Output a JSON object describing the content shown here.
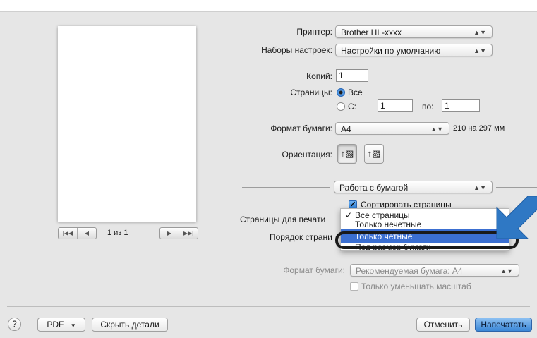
{
  "printer": {
    "label": "Принтер:",
    "value": "Brother HL-xxxx"
  },
  "presets": {
    "label": "Наборы настроек:",
    "value": "Настройки по умолчанию"
  },
  "copies": {
    "label": "Копий:",
    "value": "1"
  },
  "pages": {
    "label": "Страницы:",
    "all_label": "Все",
    "from_label": "С:",
    "from_value": "1",
    "to_label": "по:",
    "to_value": "1"
  },
  "paper_size": {
    "label": "Формат бумаги:",
    "value": "A4",
    "dimensions": "210 на 297 мм"
  },
  "orientation": {
    "label": "Ориентация:"
  },
  "section_popup": {
    "value": "Работа с бумагой"
  },
  "collate": {
    "label": "Сортировать страницы",
    "checked": true
  },
  "pages_to_print": {
    "label": "Страницы для печати"
  },
  "page_order": {
    "label": "Порядок страни"
  },
  "dropdown_menu": {
    "items": [
      "Все страницы",
      "Только нечетные",
      "Только четные",
      "Под размер бумаги"
    ],
    "checked_index": 0,
    "highlighted_index": 2
  },
  "dest_paper": {
    "label": "Формат бумаги:",
    "value": "Рекомендуемая бумага: A4"
  },
  "scale_down": {
    "label": "Только уменьшать масштаб"
  },
  "preview": {
    "page_count": "1 из 1"
  },
  "footer": {
    "help": "?",
    "pdf": "PDF",
    "hide_details": "Скрыть детали",
    "cancel": "Отменить",
    "print": "Напечатать"
  },
  "colors": {
    "accent": "#3b6fd1",
    "primary_button": "#3a86d6",
    "callout_arrow": "#2f78c4"
  }
}
